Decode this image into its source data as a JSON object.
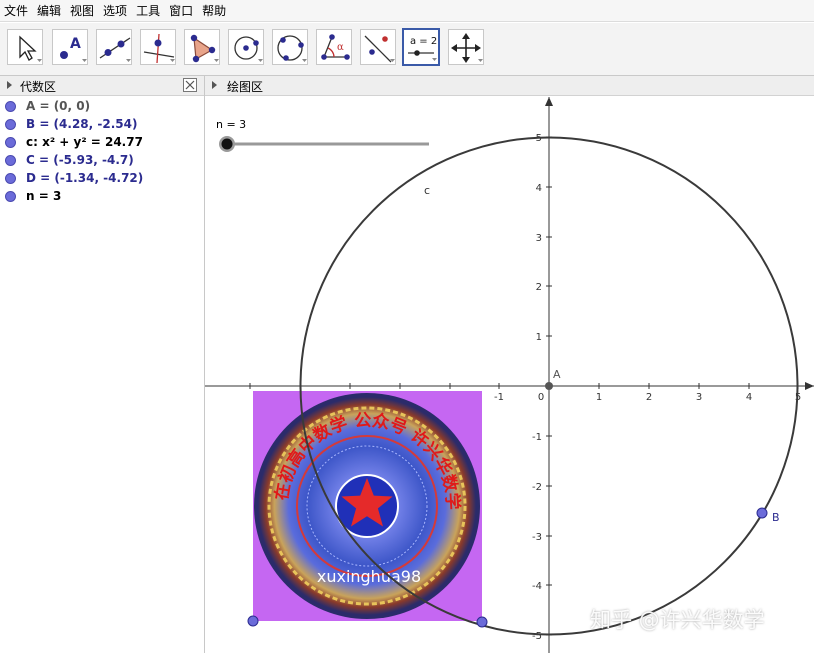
{
  "menu": [
    "文件",
    "编辑",
    "视图",
    "选项",
    "工具",
    "窗口",
    "帮助"
  ],
  "toolbar": {
    "tools": [
      {
        "icon": "move-arrow-icon"
      },
      {
        "icon": "new-point-icon"
      },
      {
        "icon": "line-through-two-points-icon"
      },
      {
        "icon": "perpendicular-line-icon"
      },
      {
        "icon": "polygon-icon"
      },
      {
        "icon": "circle-center-point-icon"
      },
      {
        "icon": "circle-three-points-icon"
      },
      {
        "icon": "angle-icon",
        "glyph": "α"
      },
      {
        "icon": "reflect-about-line-icon"
      },
      {
        "icon": "slider-icon",
        "glyph": "a = 2",
        "active": true
      },
      {
        "icon": "move-graphics-view-icon"
      }
    ]
  },
  "algebra": {
    "title": "代数区",
    "items": [
      {
        "text": "A = (0, 0)",
        "color": "#555555"
      },
      {
        "text": "B = (4.28, -2.54)",
        "color": "#2b2b8f"
      },
      {
        "text": "c: x² + y² = 24.77",
        "color": "#000000"
      },
      {
        "text": "C = (-5.93, -4.7)",
        "color": "#2b2b8f"
      },
      {
        "text": "D = (-1.34, -4.72)",
        "color": "#2b2b8f"
      },
      {
        "text": "n = 3",
        "color": "#000000"
      }
    ]
  },
  "graphics": {
    "title": "绘图区",
    "slider_label": "n = 3",
    "slider_value": 3,
    "circle_label": "c",
    "image_text": "xuxinghua98",
    "image_arc_text": "在初高中数学 公众号 许兴华数学",
    "points": [
      {
        "label": "A",
        "x": 0,
        "y": 0
      },
      {
        "label": "B",
        "x": 4.28,
        "y": -2.54
      },
      {
        "label": "",
        "x": -5.93,
        "y": -4.7
      },
      {
        "label": "",
        "x": -1.34,
        "y": -4.72
      }
    ],
    "x_ticks": [
      "-1",
      "0",
      "1",
      "2",
      "3",
      "4",
      "5"
    ],
    "y_ticks": [
      "5",
      "4",
      "3",
      "2",
      "1",
      "-1",
      "-2",
      "-3",
      "-4",
      "-5"
    ],
    "colors": {
      "point": "#6b6bd9",
      "circle": "#3a3a3a",
      "accent": "#3a5aa8"
    }
  },
  "watermark": "知乎 @许兴华数学"
}
